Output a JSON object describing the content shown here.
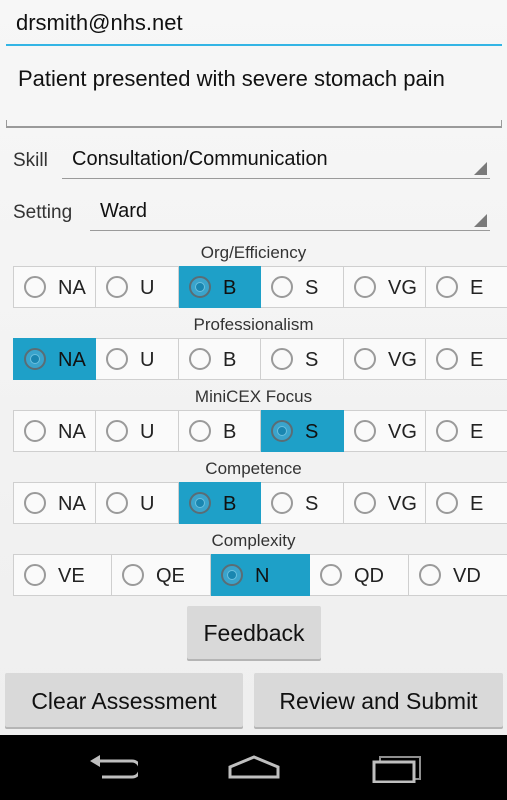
{
  "email": {
    "value": "drsmith@nhs.net"
  },
  "notes": {
    "value": "Patient presented with severe stomach pain"
  },
  "skill": {
    "label": "Skill",
    "value": "Consultation/Communication"
  },
  "setting": {
    "label": "Setting",
    "value": "Ward"
  },
  "groups": [
    {
      "title": "Org/Efficiency",
      "options": [
        "NA",
        "U",
        "B",
        "S",
        "VG",
        "E"
      ],
      "selected": "B"
    },
    {
      "title": "Professionalism",
      "options": [
        "NA",
        "U",
        "B",
        "S",
        "VG",
        "E"
      ],
      "selected": "NA"
    },
    {
      "title": "MiniCEX Focus",
      "options": [
        "NA",
        "U",
        "B",
        "S",
        "VG",
        "E"
      ],
      "selected": "S"
    },
    {
      "title": "Competence",
      "options": [
        "NA",
        "U",
        "B",
        "S",
        "VG",
        "E"
      ],
      "selected": "B"
    },
    {
      "title": "Complexity",
      "options": [
        "VE",
        "QE",
        "N",
        "QD",
        "VD"
      ],
      "selected": "N"
    }
  ],
  "buttons": {
    "feedback": "Feedback",
    "clear": "Clear Assessment",
    "review": "Review and Submit"
  },
  "navbar": {
    "icons": [
      "back-icon",
      "home-icon",
      "recent-apps-icon"
    ]
  },
  "colors": {
    "accent": "#33b5e5",
    "selected": "#1ea0c8"
  }
}
